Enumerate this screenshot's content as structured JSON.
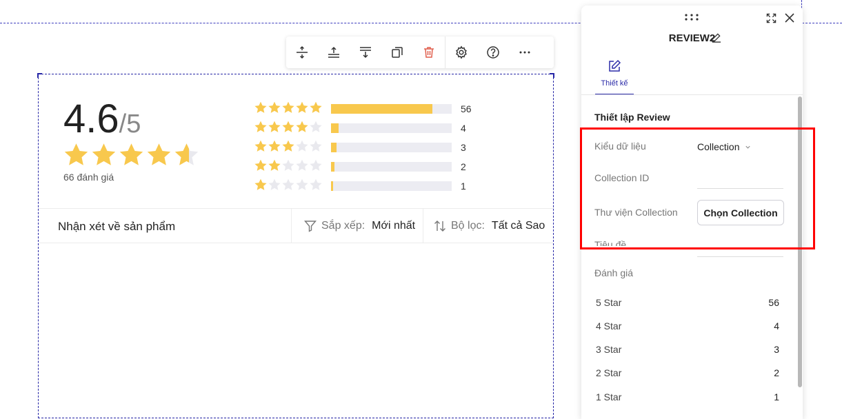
{
  "toolbar": {
    "items": [
      {
        "icon": "move-vertical-icon"
      },
      {
        "icon": "insert-above-icon"
      },
      {
        "icon": "insert-below-icon"
      },
      {
        "icon": "duplicate-icon"
      },
      {
        "icon": "delete-icon"
      },
      {
        "icon": "settings-icon"
      },
      {
        "icon": "help-icon"
      },
      {
        "icon": "more-icon"
      }
    ]
  },
  "review": {
    "score": "4.6",
    "score_denominator": "/5",
    "rating": 4.6,
    "count_text": "66 đánh giá",
    "distribution": [
      {
        "stars": 5,
        "count": "56",
        "fraction": 0.84
      },
      {
        "stars": 4,
        "count": "4",
        "fraction": 0.06
      },
      {
        "stars": 3,
        "count": "3",
        "fraction": 0.045
      },
      {
        "stars": 2,
        "count": "2",
        "fraction": 0.03
      },
      {
        "stars": 1,
        "count": "1",
        "fraction": 0.015
      }
    ],
    "filter_bar": {
      "title": "Nhận xét về sản phẩm",
      "sort_label": "Sắp xếp:",
      "sort_value": "Mới nhất",
      "filter_label": "Bộ lọc:",
      "filter_value": "Tất cả Sao"
    }
  },
  "panel": {
    "title": "REVIEW2",
    "tab_label": "Thiết kế",
    "section_title": "Thiết lập Review",
    "data_type_label": "Kiểu dữ liệu",
    "data_type_value": "Collection",
    "collection_id_label": "Collection ID",
    "collection_id_value": "",
    "library_label": "Thư viện Collection",
    "choose_button": "Chọn Collection",
    "heading_label": "Tiêu đề",
    "rating_label": "Đánh giá",
    "star_rows": [
      {
        "label": "5 Star",
        "value": "56"
      },
      {
        "label": "4 Star",
        "value": "4"
      },
      {
        "label": "3 Star",
        "value": "3"
      },
      {
        "label": "2 Star",
        "value": "2"
      },
      {
        "label": "1 Star",
        "value": "1"
      }
    ]
  },
  "colors": {
    "star": "#f8c84d",
    "star_empty": "#e9e9ee",
    "accent": "#2b2ba8",
    "delete": "#e05d4b",
    "highlight": "#ff0000"
  }
}
